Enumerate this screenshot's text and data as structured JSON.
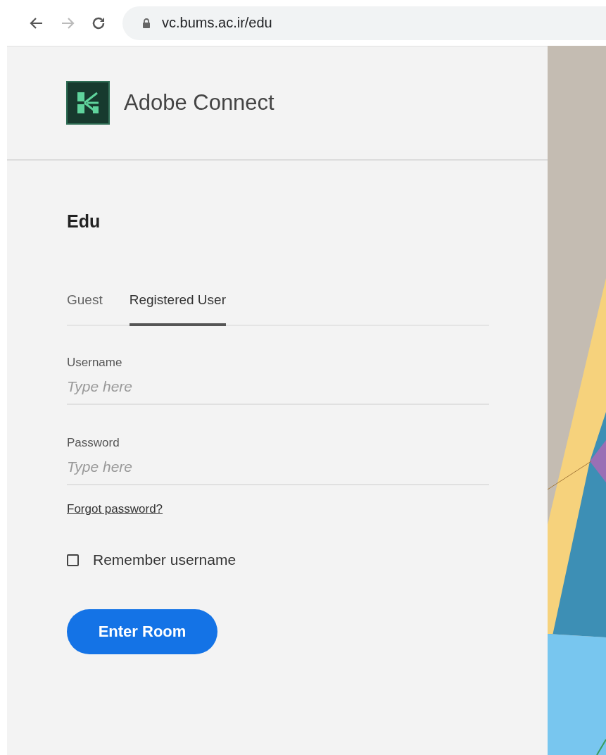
{
  "browser": {
    "url": "vc.bums.ac.ir/edu"
  },
  "header": {
    "app_name": "Adobe Connect"
  },
  "room_title": "Edu",
  "tabs": [
    {
      "label": "Guest",
      "selected": false
    },
    {
      "label": "Registered User",
      "selected": true
    }
  ],
  "fields": [
    {
      "label": "Username",
      "placeholder": "Type here"
    },
    {
      "label": "Password",
      "placeholder": "Type here"
    }
  ],
  "forgot_link": "Forgot password?",
  "remember": {
    "label": "Remember username",
    "checked": false
  },
  "submit_button": "Enter Room"
}
